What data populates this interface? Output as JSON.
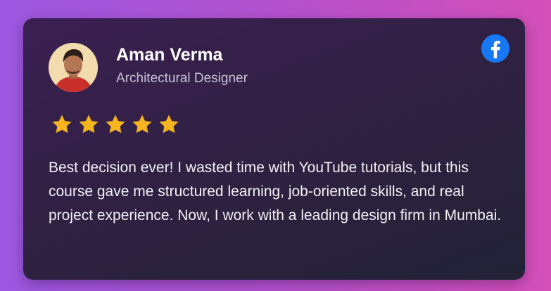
{
  "testimonial": {
    "name": "Aman Verma",
    "role": "Architectural Designer",
    "rating": 5,
    "rating_max": 5,
    "review": "Best decision ever! I wasted time with YouTube tutorials, but this course gave me structured learning, job-oriented skills, and real project experience. Now, I work with a leading design firm in Mumbai.",
    "social_icon": "facebook-icon"
  },
  "colors": {
    "star": "#f6b51e",
    "facebook": "#1877f2",
    "card_top": "#3b1f52",
    "card_bottom": "#222336"
  }
}
